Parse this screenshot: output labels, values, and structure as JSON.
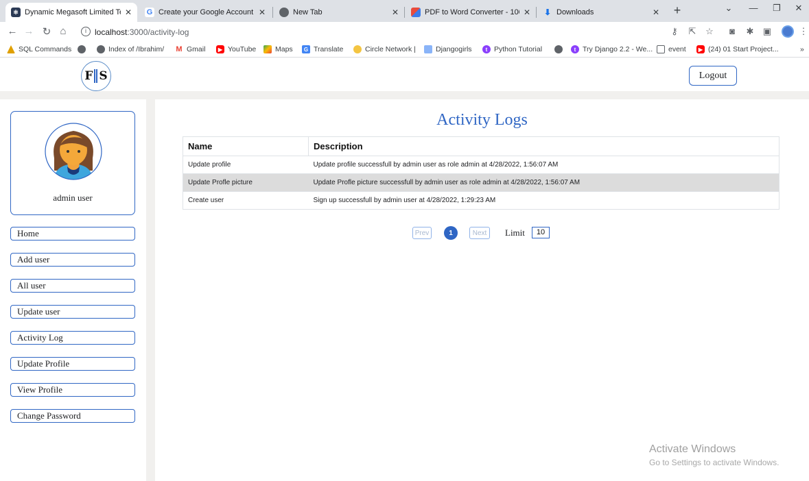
{
  "browser": {
    "tabs": [
      {
        "title": "Dynamic Megasoft Limited Tech",
        "active": true,
        "fav_color": "#2b3a55"
      },
      {
        "title": "Create your Google Account",
        "active": false,
        "fav_color": "#4285f4"
      },
      {
        "title": "New Tab",
        "active": false,
        "fav_color": "#5f6368"
      },
      {
        "title": "PDF to Word Converter - 100%",
        "active": false,
        "fav_color": "#e94b3c"
      },
      {
        "title": "Downloads",
        "active": false,
        "fav_color": "#1a73e8"
      }
    ],
    "url_host": "localhost",
    "url_path": ":3000/activity-log",
    "bookmarks": [
      "SQL Commands",
      "",
      "Index of /Ibrahim/",
      "Gmail",
      "YouTube",
      "Maps",
      "Translate",
      "Circle Network |",
      "Djangogirls",
      "Python Tutorial",
      "",
      "Try Django 2.2 - We...",
      "event",
      "(24) 01 Start Project..."
    ],
    "bookmarks_more": "»"
  },
  "header": {
    "logo_left": "F",
    "logo_right": "S",
    "logout_label": "Logout"
  },
  "sidebar": {
    "user_name": "admin user",
    "links": [
      "Home",
      "Add user",
      "All user",
      "Update user",
      "Activity Log",
      "Update Profile",
      "View Profile",
      "Change Password"
    ]
  },
  "main": {
    "title": "Activity Logs",
    "columns": [
      "Name",
      "Description"
    ],
    "rows": [
      {
        "name": "Update profile",
        "description": "Update profile successfull by admin user as role admin at 4/28/2022, 1:56:07 AM"
      },
      {
        "name": "Update Profle picture",
        "description": "Update Profle picture successfull by admin user as role admin at 4/28/2022, 1:56:07 AM"
      },
      {
        "name": "Create user",
        "description": "Sign up successfull by admin user at 4/28/2022, 1:29:23 AM"
      }
    ],
    "pager": {
      "prev_label": "Prev",
      "current_page": "1",
      "next_label": "Next",
      "limit_label": "Limit",
      "limit_value": "10"
    }
  },
  "watermark": {
    "line1": "Activate Windows",
    "line2": "Go to Settings to activate Windows."
  }
}
